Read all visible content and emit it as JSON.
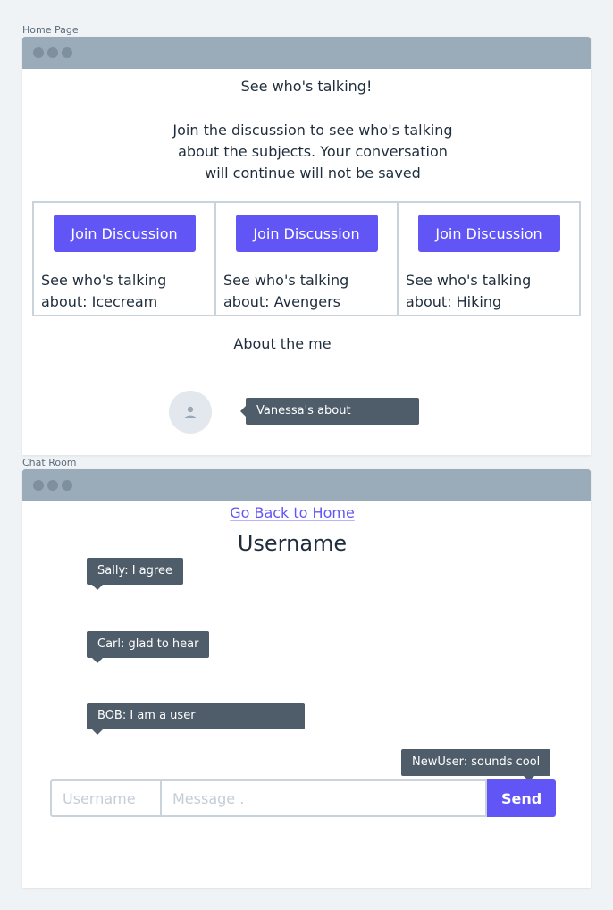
{
  "home": {
    "frame_label": "Home Page",
    "title": "See who's talking!",
    "description": "Join the discussion to see who's talking about the subjects. Your conversation will continue will not be saved",
    "cards": [
      {
        "button": "Join Discussion",
        "text": "See who's talking about: Icecream"
      },
      {
        "button": "Join Discussion",
        "text": "See who's talking about: Avengers"
      },
      {
        "button": "Join Discussion",
        "text": "See who's talking about: Hiking"
      }
    ],
    "about_title": "About the me",
    "about_tooltip": "Vanessa's about"
  },
  "chat": {
    "frame_label": "Chat Room",
    "back_link": "Go Back to Home",
    "username_title": "Username",
    "messages": [
      "Sally: I agree",
      "Carl: glad to hear",
      "BOB: I am a user",
      "NewUser: sounds cool"
    ],
    "username_placeholder": "Username",
    "message_placeholder": "Message .",
    "send_label": "Send"
  },
  "icons": {
    "window_controls": "window-dots",
    "avatar": "user-icon"
  },
  "colors": {
    "accent": "#6155f5",
    "titlebar": "#9aabb9",
    "tooltip": "#4f5d6a",
    "border": "#c8d3dc"
  }
}
